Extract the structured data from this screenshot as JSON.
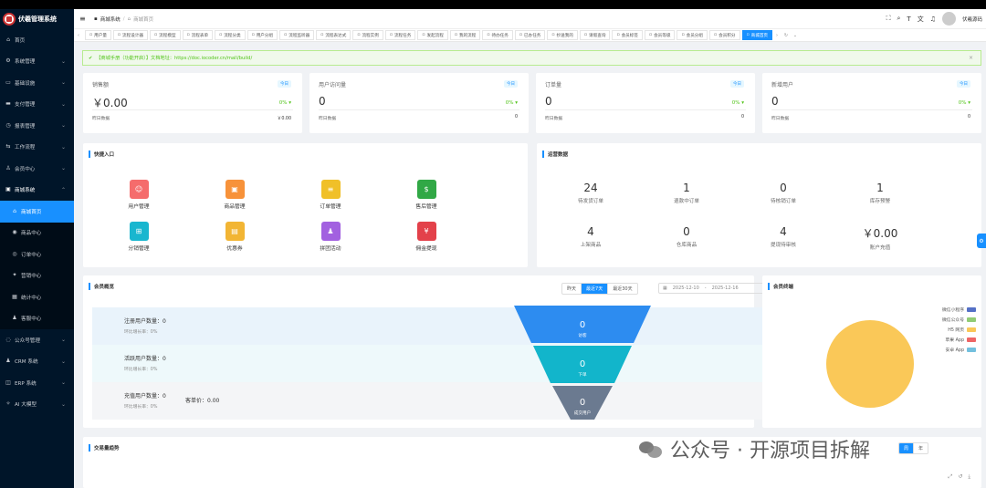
{
  "app": {
    "title": "伏羲管理系统"
  },
  "sidebar": {
    "items": [
      {
        "label": "首页",
        "icon": "home-icon"
      },
      {
        "label": "系统管理",
        "icon": "gear-icon"
      },
      {
        "label": "基础设施",
        "icon": "monitor-icon"
      },
      {
        "label": "支付管理",
        "icon": "card-icon"
      },
      {
        "label": "报表管理",
        "icon": "clock-icon"
      },
      {
        "label": "工作流程",
        "icon": "flow-icon"
      },
      {
        "label": "会员中心",
        "icon": "member-icon"
      },
      {
        "label": "商城系统",
        "icon": "shop-icon"
      },
      {
        "label": "商城首页",
        "icon": "home-icon"
      },
      {
        "label": "商品中心",
        "icon": "goods-icon"
      },
      {
        "label": "订单中心",
        "icon": "order-icon"
      },
      {
        "label": "营销中心",
        "icon": "marketing-icon"
      },
      {
        "label": "统计中心",
        "icon": "stats-icon"
      },
      {
        "label": "客服中心",
        "icon": "user-icon"
      },
      {
        "label": "公众号管理",
        "icon": "wechat-icon"
      },
      {
        "label": "CRM 系统",
        "icon": "user-icon"
      },
      {
        "label": "ERP 系统",
        "icon": "erp-icon"
      },
      {
        "label": "AI 大模型",
        "icon": "ai-icon"
      }
    ]
  },
  "header": {
    "crumb1": "商城系统",
    "crumb_sep": "/",
    "crumb2": "商城首页",
    "user": "伏羲源码"
  },
  "tabs": [
    "用户量",
    "流程设计器",
    "流程模型",
    "流程表单",
    "流程分类",
    "用户分组",
    "流程监听器",
    "流程表达式",
    "流程实例",
    "流程任务",
    "发起流程",
    "我的流程",
    "待办任务",
    "已办任务",
    "抄送我的",
    "请假查询",
    "会员标签",
    "会员等级",
    "会员分组",
    "会员积分",
    "商城首页"
  ],
  "alert": {
    "text": "【商城手册（功能开启）】文档地址：https://doc.iocoder.cn/mall/build/"
  },
  "stats": [
    {
      "label": "销售额",
      "badge": "今日",
      "value": "￥0.00",
      "pct": "0%",
      "yday_label": "昨日数据",
      "yday_value": "￥0.00"
    },
    {
      "label": "用户访问量",
      "badge": "今日",
      "value": "0",
      "pct": "0%",
      "yday_label": "昨日数据",
      "yday_value": "0"
    },
    {
      "label": "订单量",
      "badge": "今日",
      "value": "0",
      "pct": "0%",
      "yday_label": "昨日数据",
      "yday_value": "0"
    },
    {
      "label": "新增用户",
      "badge": "今日",
      "value": "0",
      "pct": "0%",
      "yday_label": "昨日数据",
      "yday_value": "0"
    }
  ],
  "quick": {
    "title": "快捷入口",
    "items": [
      {
        "label": "用户管理",
        "color": "#f56c6c",
        "glyph": "☺"
      },
      {
        "label": "商品管理",
        "color": "#f7923a",
        "glyph": "▣"
      },
      {
        "label": "订单管理",
        "color": "#f0c029",
        "glyph": "≡"
      },
      {
        "label": "售后管理",
        "color": "#31a846",
        "glyph": "$"
      },
      {
        "label": "分销管理",
        "color": "#19b6cf",
        "glyph": "⊞"
      },
      {
        "label": "优惠券",
        "color": "#f2b534",
        "glyph": "▤"
      },
      {
        "label": "拼团活动",
        "color": "#a261e0",
        "glyph": "♟"
      },
      {
        "label": "佣金提现",
        "color": "#e3414a",
        "glyph": "¥"
      }
    ]
  },
  "ops": {
    "title": "运营数据",
    "items": [
      {
        "value": "24",
        "label": "待发货订单"
      },
      {
        "value": "1",
        "label": "退款中订单"
      },
      {
        "value": "0",
        "label": "待核销订单"
      },
      {
        "value": "1",
        "label": "库存预警"
      },
      {
        "value": "4",
        "label": "上架商品"
      },
      {
        "value": "0",
        "label": "仓库商品"
      },
      {
        "value": "4",
        "label": "提现待审核"
      },
      {
        "value": "￥0.00",
        "label": "账户充值"
      }
    ]
  },
  "member": {
    "title": "会员概览",
    "seg": [
      "昨天",
      "最近7天",
      "最近30天"
    ],
    "date_from": "2025-12-10",
    "date_sep": "-",
    "date_to": "2025-12-16",
    "rows": [
      {
        "a": "注册用户数量：0",
        "b": "环比增长率：0%"
      },
      {
        "a": "活跃用户数量：0",
        "b": "环比增长率：0%"
      },
      {
        "a": "充值用户数量：0",
        "b": "环比增长率：0%",
        "extra": "客单价：0.00"
      }
    ],
    "funnel": [
      {
        "value": "0",
        "label": "访客"
      },
      {
        "value": "0",
        "label": "下单"
      },
      {
        "value": "0",
        "label": "成交用户"
      }
    ]
  },
  "terminal": {
    "title": "会员终端",
    "legend": [
      {
        "name": "微信小程序",
        "color": "#5470c6"
      },
      {
        "name": "微信公众号",
        "color": "#91cc75"
      },
      {
        "name": "H5 网页",
        "color": "#fac858"
      },
      {
        "name": "苹果 App",
        "color": "#ee6666"
      },
      {
        "name": "安卓 App",
        "color": "#73c0de"
      }
    ],
    "pie_color": "#fac858"
  },
  "trend": {
    "title": "交易量趋势",
    "seg": [
      "周",
      "年"
    ]
  },
  "watermark": {
    "text": "公众号 · 开源项目拆解"
  }
}
